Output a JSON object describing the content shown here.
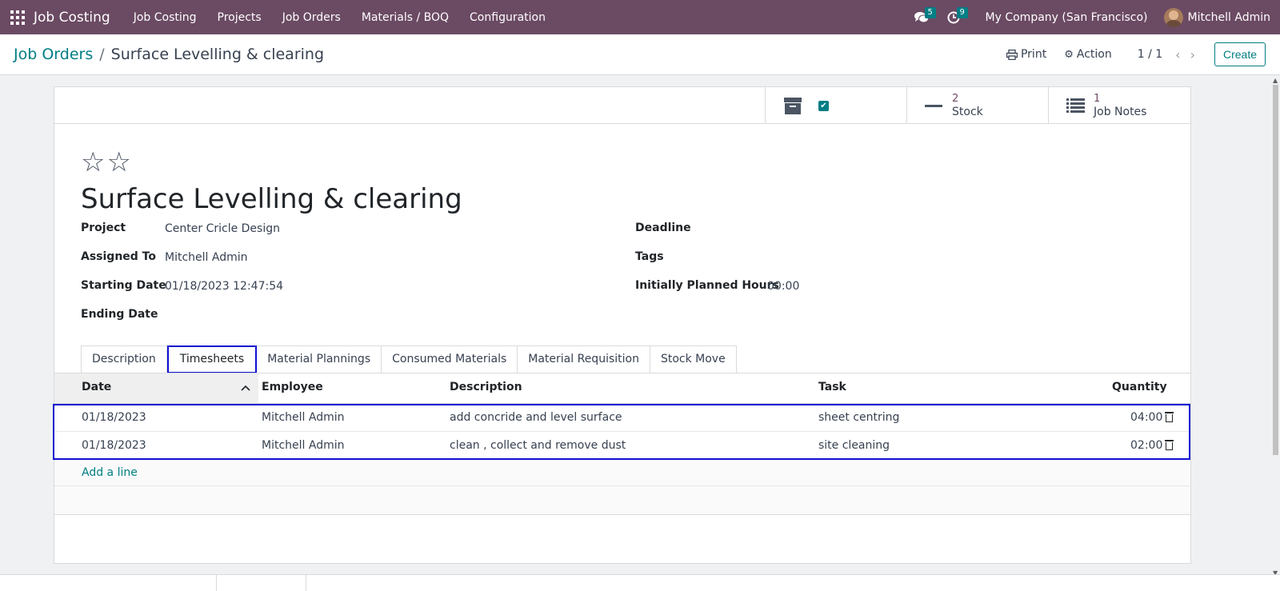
{
  "navbar": {
    "brand": "Job Costing",
    "menu": [
      "Job Costing",
      "Projects",
      "Job Orders",
      "Materials / BOQ",
      "Configuration"
    ],
    "messages_count": "5",
    "activities_count": "9",
    "company": "My Company (San Francisco)",
    "user": "Mitchell Admin"
  },
  "control": {
    "breadcrumb_parent": "Job Orders",
    "breadcrumb_current": "Surface Levelling & clearing",
    "print_label": "Print",
    "action_label": "Action",
    "pager": "1 / 1",
    "create_label": "Create"
  },
  "smart_buttons": {
    "stock_count": "2",
    "stock_label": "Stock",
    "notes_count": "1",
    "notes_label": "Job Notes"
  },
  "form": {
    "title": "Surface Levelling & clearing",
    "project_label": "Project",
    "project_value": "Center Cricle Design",
    "assigned_label": "Assigned To",
    "assigned_value": "Mitchell Admin",
    "start_label": "Starting Date",
    "start_value": "01/18/2023 12:47:54",
    "end_label": "Ending Date",
    "deadline_label": "Deadline",
    "tags_label": "Tags",
    "planned_label": "Initially Planned Hours",
    "planned_value": "00:00"
  },
  "tabs": [
    "Description",
    "Timesheets",
    "Material Plannings",
    "Consumed Materials",
    "Material Requisition",
    "Stock Move"
  ],
  "timesheet": {
    "headers": {
      "date": "Date",
      "employee": "Employee",
      "description": "Description",
      "task": "Task",
      "quantity": "Quantity"
    },
    "rows": [
      {
        "date": "01/18/2023",
        "employee": "Mitchell Admin",
        "description": "add concride and level surface",
        "task": "sheet centring",
        "quantity": "04:00"
      },
      {
        "date": "01/18/2023",
        "employee": "Mitchell Admin",
        "description": "clean , collect and remove dust",
        "task": "site cleaning",
        "quantity": "02:00"
      }
    ],
    "add_line": "Add a line"
  },
  "colors": {
    "navbar": "#6b4a63",
    "accent": "#017e84",
    "highlight": "#1010d0"
  }
}
